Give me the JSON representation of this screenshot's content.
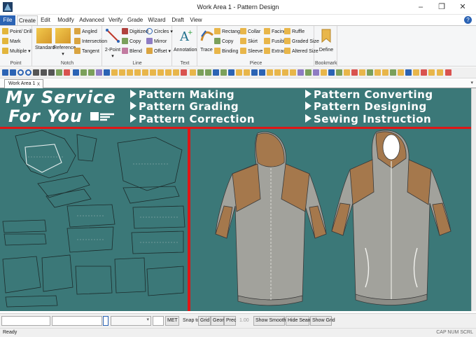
{
  "window": {
    "title": "Work Area 1 - Pattern Design",
    "minimize": "–",
    "maximize": "❐",
    "close": "✕"
  },
  "menu": {
    "tabs": [
      "File",
      "Create",
      "Edit",
      "Modify",
      "Advanced",
      "Verify",
      "Grade",
      "Wizard",
      "Draft",
      "View"
    ],
    "active": "Create",
    "help": "?"
  },
  "ribbon": {
    "groups": [
      {
        "label": "Point",
        "items": [
          "Point/ Drill",
          "Mark",
          "Multiple ▾"
        ]
      },
      {
        "label": "Notch",
        "items": [
          "Standard",
          "Reference ▾",
          "Angled",
          "Intersection",
          "Tangent"
        ]
      },
      {
        "label": "Line",
        "items": [
          "2-Point ▾",
          "Digitized",
          "Copy",
          "Blend",
          "Circles ▾",
          "Mirror",
          "Offset ▾"
        ]
      },
      {
        "label": "Text",
        "items": [
          "Annotation"
        ]
      },
      {
        "label": "Piece",
        "items": [
          "Trace",
          "Rectangle",
          "Copy",
          "Binding",
          "Collar",
          "Skirt",
          "Sleeve ▾",
          "Facing",
          "Fusible",
          "Extract",
          "Ruffle",
          "Graded Size",
          "Altered Size"
        ]
      },
      {
        "label": "Bookmark",
        "items": [
          "Define"
        ]
      }
    ]
  },
  "document": {
    "tab_label": "Work Area 1",
    "tab_close": "x",
    "tab_menu": "▾"
  },
  "banner": {
    "left_line1": "My Service",
    "left_line2": "For You",
    "services": [
      "Pattern Making",
      "Pattern Grading",
      "Pattern Correction",
      "Pattern Converting",
      "Pattern Designing",
      "Sewing Instruction"
    ]
  },
  "bottom": {
    "met": "MET",
    "snap_label": "Snap to:",
    "grid": "Grid",
    "geom": "Geom",
    "prec": "Prec",
    "prec_value": "1.00",
    "show_smoothing": "Show Smoothing",
    "hide_seams": "Hide Seams",
    "show_grid": "Show Grid"
  },
  "status": {
    "ready": "Ready",
    "indicators": "CAP NUM SCRL"
  },
  "colors": {
    "canvas": "#3b7878",
    "accent_red": "#e01616",
    "file_tab": "#2b63b4",
    "jacket_body": "#a2a29c",
    "jacket_panel": "#a5784c"
  }
}
